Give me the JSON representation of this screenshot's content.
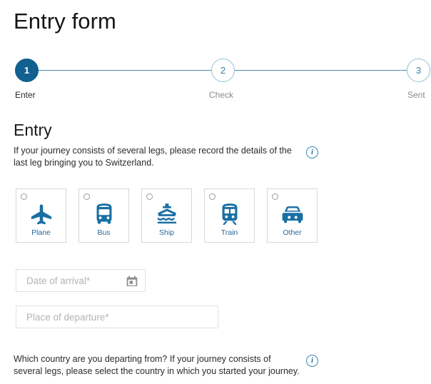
{
  "page": {
    "title": "Entry form"
  },
  "colors": {
    "accent_active": "#11608f",
    "accent_line": "#4e8eb3",
    "icon_blue": "#1a6fa3",
    "label_blue": "#24689a",
    "info_blue": "#3d87b5",
    "muted_text": "#8a8a8a",
    "card_border": "#d8d8d8",
    "field_border": "#e2e2e2"
  },
  "stepper": {
    "steps": [
      {
        "number": "1",
        "label": "Enter",
        "state": "active"
      },
      {
        "number": "2",
        "label": "Check",
        "state": "inactive"
      },
      {
        "number": "3",
        "label": "Sent",
        "state": "inactive"
      }
    ]
  },
  "section": {
    "heading": "Entry",
    "intro_text": "If your journey consists of several legs, please record the details of the last leg bringing you to Switzerland.",
    "intro_info_icon": "info-icon",
    "outro_text": "Which country are you departing from? If your journey consists of several legs, please select the country in which you started your journey.",
    "outro_info_icon": "info-icon"
  },
  "transport": {
    "options": [
      {
        "label": "Plane",
        "icon": "plane-icon",
        "selected": false
      },
      {
        "label": "Bus",
        "icon": "bus-icon",
        "selected": false
      },
      {
        "label": "Ship",
        "icon": "ship-icon",
        "selected": false
      },
      {
        "label": "Train",
        "icon": "train-icon",
        "selected": false
      },
      {
        "label": "Other",
        "icon": "car-icon",
        "selected": false
      }
    ]
  },
  "fields": {
    "date_of_arrival": {
      "placeholder": "Date of arrival*",
      "value": "",
      "icon": "calendar-icon"
    },
    "place_of_departure": {
      "placeholder": "Place of departure*",
      "value": ""
    }
  }
}
